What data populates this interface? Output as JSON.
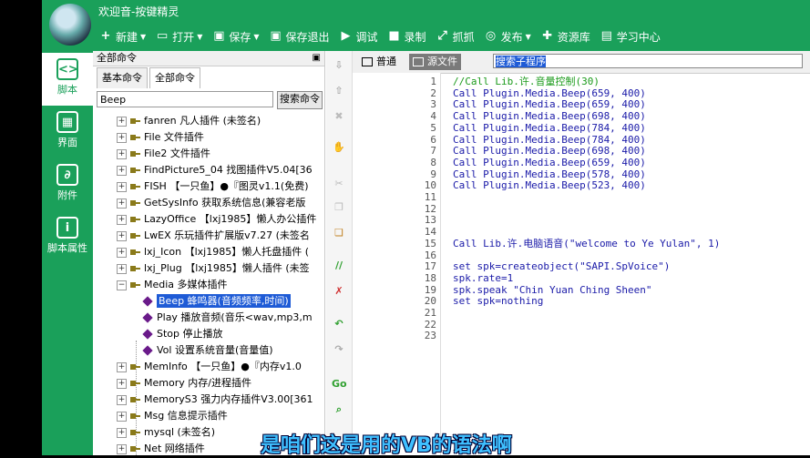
{
  "window": {
    "title": "欢迎音-按键精灵"
  },
  "toolbar": [
    {
      "label": "新建",
      "icon": "plus-icon",
      "glyph": "+",
      "caret": true
    },
    {
      "label": "打开",
      "icon": "folder-icon",
      "glyph": "▭",
      "caret": true
    },
    {
      "label": "保存",
      "icon": "save-icon",
      "glyph": "▣",
      "caret": true
    },
    {
      "label": "保存退出",
      "icon": "save-exit-icon",
      "glyph": "▣",
      "caret": false
    },
    {
      "label": "调试",
      "icon": "play-icon",
      "glyph": "▶",
      "caret": false
    },
    {
      "label": "录制",
      "icon": "camera-icon",
      "glyph": "■",
      "caret": false
    },
    {
      "label": "抓抓",
      "icon": "capture-icon",
      "glyph": "⤢",
      "caret": false
    },
    {
      "label": "发布",
      "icon": "publish-icon",
      "glyph": "◎",
      "caret": true
    },
    {
      "label": "资源库",
      "icon": "resource-icon",
      "glyph": "✚",
      "caret": false
    },
    {
      "label": "学习中心",
      "icon": "book-icon",
      "glyph": "▤",
      "caret": false
    }
  ],
  "leftnav": [
    {
      "label": "脚本",
      "icon": "script-icon",
      "glyph": "<>",
      "active": true
    },
    {
      "label": "界面",
      "icon": "layout-icon",
      "glyph": "▦",
      "active": false
    },
    {
      "label": "附件",
      "icon": "paperclip-icon",
      "glyph": "∂",
      "active": false
    },
    {
      "label": "脚本属性",
      "icon": "info-icon",
      "glyph": "i",
      "active": false
    }
  ],
  "panel": {
    "header": "全部命令",
    "pin": "📌",
    "tabs": [
      "基本命令",
      "全部命令"
    ],
    "search_value": "Beep",
    "search_button": "搜索命令"
  },
  "tree": [
    {
      "label": "fanren 凡人插件 (未签名)",
      "level": 0,
      "exp": "+"
    },
    {
      "label": "File 文件插件",
      "level": 0,
      "exp": "+"
    },
    {
      "label": "File2 文件插件",
      "level": 0,
      "exp": "+"
    },
    {
      "label": "FindPicture5_04 找图插件V5.04[36",
      "level": 0,
      "exp": "+"
    },
    {
      "label": "FISH 【一只鱼】●『图灵v1.1(免费)",
      "level": 0,
      "exp": "+"
    },
    {
      "label": "GetSysInfo 获取系统信息(兼容老版",
      "level": 0,
      "exp": "+"
    },
    {
      "label": "LazyOffice 【lxj1985】懒人办公插件",
      "level": 0,
      "exp": "+"
    },
    {
      "label": "LwEX 乐玩插件扩展版v7.27 (未签名",
      "level": 0,
      "exp": "+"
    },
    {
      "label": "lxj_Icon 【lxj1985】懒人托盘插件 (",
      "level": 0,
      "exp": "+"
    },
    {
      "label": "lxj_Plug 【lxj1985】懒人插件 (未签",
      "level": 0,
      "exp": "+"
    },
    {
      "label": "Media 多媒体插件",
      "level": 0,
      "exp": "−"
    },
    {
      "label": "Beep 蜂鸣器(音频频率,时间)",
      "level": 1,
      "selected": true
    },
    {
      "label": "Play 播放音频(音乐<wav,mp3,m",
      "level": 1
    },
    {
      "label": "Stop 停止播放",
      "level": 1
    },
    {
      "label": "Vol 设置系统音量(音量值)",
      "level": 1
    },
    {
      "label": "MemInfo 【一只鱼】●『内存v1.0",
      "level": 0,
      "exp": "+"
    },
    {
      "label": "Memory 内存/进程插件",
      "level": 0,
      "exp": "+"
    },
    {
      "label": "MemoryS3 强力内存插件V3.00[361",
      "level": 0,
      "exp": "+"
    },
    {
      "label": "Msg 信息提示插件",
      "level": 0,
      "exp": "+"
    },
    {
      "label": "mysql (未签名)",
      "level": 0,
      "exp": "+"
    },
    {
      "label": "Net 网络插件",
      "level": 0,
      "exp": "+"
    }
  ],
  "toolstrip": [
    {
      "icon": "arrow-down-icon",
      "glyph": "⇩",
      "color": "#aaaaaa"
    },
    {
      "icon": "arrow-up-icon",
      "glyph": "⇧",
      "color": "#aaaaaa"
    },
    {
      "icon": "delete-icon",
      "glyph": "✖",
      "color": "#bbbbbb"
    },
    {
      "icon": "hand-icon",
      "glyph": "✋",
      "color": "#d08020"
    },
    {
      "icon": "cut-icon",
      "glyph": "✂",
      "color": "#bbbbbb"
    },
    {
      "icon": "copy-icon",
      "glyph": "❐",
      "color": "#bbbbbb"
    },
    {
      "icon": "paste-icon",
      "glyph": "❏",
      "color": "#c08020"
    },
    {
      "icon": "comment-icon",
      "glyph": "//",
      "color": "#30a030"
    },
    {
      "icon": "uncomment-icon",
      "glyph": "✗",
      "color": "#d03030"
    },
    {
      "icon": "undo-icon",
      "glyph": "↶",
      "color": "#30a030"
    },
    {
      "icon": "redo-icon",
      "glyph": "↷",
      "color": "#aaaaaa"
    },
    {
      "icon": "goto-icon",
      "glyph": "Go",
      "color": "#30a030"
    },
    {
      "icon": "find-icon",
      "glyph": "⌕",
      "color": "#30a030"
    }
  ],
  "editor": {
    "tab_normal": "普通",
    "tab_source": "源文件",
    "search_sub": "搜索子程序",
    "lines": [
      {
        "n": "1",
        "text": "//Call Lib.许.音量控制(30)",
        "type": "cmt"
      },
      {
        "n": "2",
        "text": "Call Plugin.Media.Beep(659, 400)"
      },
      {
        "n": "3",
        "text": "Call Plugin.Media.Beep(659, 400)"
      },
      {
        "n": "4",
        "text": "Call Plugin.Media.Beep(698, 400)"
      },
      {
        "n": "5",
        "text": "Call Plugin.Media.Beep(784, 400)"
      },
      {
        "n": "6",
        "text": "Call Plugin.Media.Beep(784, 400)"
      },
      {
        "n": "7",
        "text": "Call Plugin.Media.Beep(698, 400)"
      },
      {
        "n": "8",
        "text": "Call Plugin.Media.Beep(659, 400)"
      },
      {
        "n": "9",
        "text": "Call Plugin.Media.Beep(578, 400)"
      },
      {
        "n": "10",
        "text": "Call Plugin.Media.Beep(523, 400)"
      },
      {
        "n": "11",
        "text": ""
      },
      {
        "n": "12",
        "text": ""
      },
      {
        "n": "13",
        "text": ""
      },
      {
        "n": "14",
        "text": ""
      },
      {
        "n": "15",
        "text": "Call Lib.许.电脑语音(\"welcome to Ye Yulan\", 1)"
      },
      {
        "n": "16",
        "text": ""
      },
      {
        "n": "17",
        "text": "set spk=createobject(\"SAPI.SpVoice\")"
      },
      {
        "n": "18",
        "text": "spk.rate=1"
      },
      {
        "n": "19",
        "text": "spk.speak \"Chin Yuan Ching Sheen\""
      },
      {
        "n": "20",
        "text": "set spk=nothing"
      },
      {
        "n": "21",
        "text": ""
      },
      {
        "n": "22",
        "text": ""
      },
      {
        "n": "23",
        "text": ""
      }
    ]
  },
  "caption": "是咱们这是用的VB的语法啊",
  "colors": {
    "brand_green": "#1aa05a",
    "selection_blue": "#1e5bd6",
    "code_blue": "#1a1aa8",
    "comment_green": "#1a9a1a",
    "caption_blue": "#3fc0ff"
  }
}
